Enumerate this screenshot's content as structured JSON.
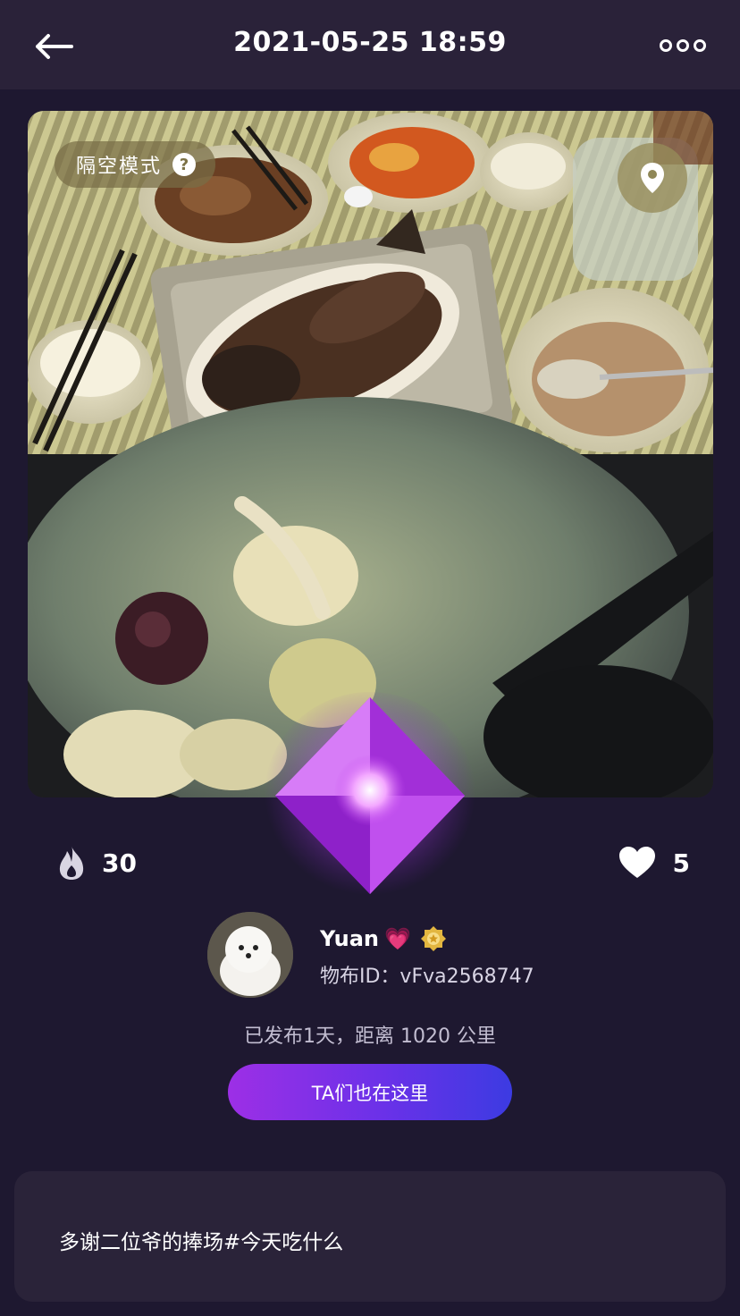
{
  "header": {
    "title": "2021-05-25 18:59"
  },
  "photo": {
    "mode_label": "隔空模式",
    "help_glyph": "?"
  },
  "stats": {
    "heat": "30",
    "likes": "5"
  },
  "user": {
    "name": "Yuan",
    "heart_emoji": "💗",
    "id_text": "物布ID：vFva2568747"
  },
  "post": {
    "meta": "已发布1天，距离 1020 公里",
    "action_label": "TA们也在这里",
    "description": "多谢二位爷的捧场#今天吃什么"
  },
  "icons": {
    "back": "back-arrow-icon",
    "more": "more-options-icon",
    "location": "location-pin-icon",
    "heat": "flame-icon",
    "like": "heart-icon",
    "badge": "gold-badge-icon",
    "gem": "purple-gem-icon"
  },
  "colors": {
    "background": "#1e1830",
    "header": "#2a2239",
    "button_gradient_start": "#9d2fe6",
    "button_gradient_end": "#3c3be2",
    "badge": "#e3b640"
  }
}
